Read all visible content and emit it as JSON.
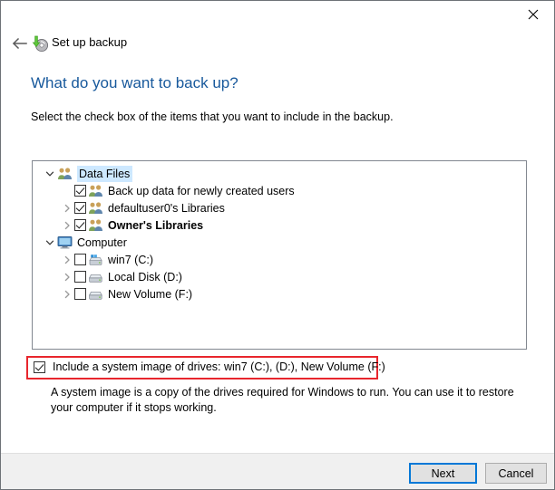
{
  "window": {
    "close_label": "✕"
  },
  "nav": {
    "back_label": "←",
    "icon_name": "backup-disc-icon",
    "crumb": "Set up backup"
  },
  "heading": {
    "title": "What do you want to back up?",
    "subtitle": "Select the check box of the items that you want to include in the backup."
  },
  "tree": {
    "nodes": [
      {
        "label": "Data Files",
        "level": 0,
        "expander": "expanded",
        "checkbox": "none",
        "icon": "users-group-icon",
        "bold": false,
        "selected": true
      },
      {
        "label": "Back up data for newly created users",
        "level": 1,
        "expander": "none",
        "checkbox": "checked",
        "icon": "users-group-icon",
        "bold": false,
        "selected": false
      },
      {
        "label": "defaultuser0's Libraries",
        "level": 1,
        "expander": "collapsed",
        "checkbox": "checked",
        "icon": "users-group-icon",
        "bold": false,
        "selected": false
      },
      {
        "label": "Owner's Libraries",
        "level": 1,
        "expander": "collapsed",
        "checkbox": "checked",
        "icon": "users-group-icon",
        "bold": true,
        "selected": false
      },
      {
        "label": "Computer",
        "level": 0,
        "expander": "expanded",
        "checkbox": "none",
        "icon": "monitor-icon",
        "bold": false,
        "selected": false
      },
      {
        "label": "win7 (C:)",
        "level": 1,
        "expander": "collapsed",
        "checkbox": "unchecked",
        "icon": "windows-drive-icon",
        "bold": false,
        "selected": false
      },
      {
        "label": "Local Disk (D:)",
        "level": 1,
        "expander": "collapsed",
        "checkbox": "unchecked",
        "icon": "hard-drive-icon",
        "bold": false,
        "selected": false
      },
      {
        "label": "New Volume (F:)",
        "level": 1,
        "expander": "collapsed",
        "checkbox": "unchecked",
        "icon": "hard-drive-icon",
        "bold": false,
        "selected": false
      }
    ]
  },
  "system_image": {
    "checkbox": "checked",
    "label": "Include a system image of drives: win7 (C:), (D:), New Volume (F:)",
    "description": "A system image is a copy of the drives required for Windows to run. You can use it to restore your computer if it stops working.",
    "highlight_color": "#e8262d"
  },
  "footer": {
    "next_label": "Next",
    "cancel_label": "Cancel",
    "focus_color": "#0078d7"
  }
}
